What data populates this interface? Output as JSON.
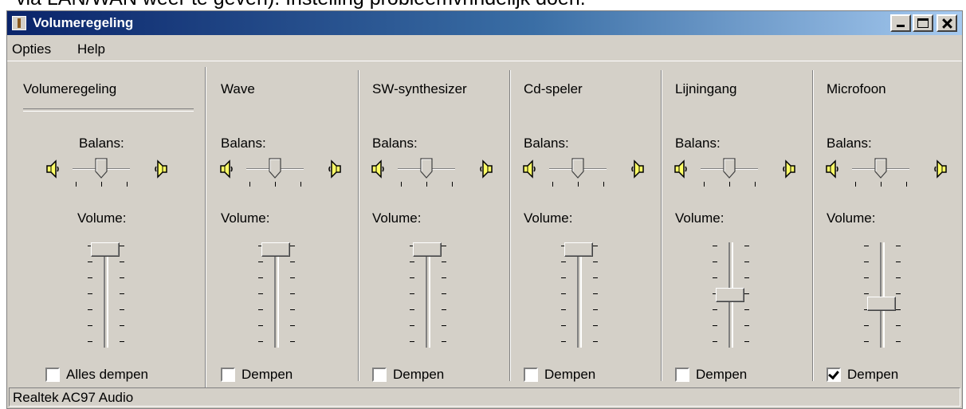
{
  "doc_text": "via LAN/WAN weer te geven). Instelling probleemvrindelijk doen.",
  "window": {
    "title": "Volumeregeling"
  },
  "menu": [
    "Opties",
    "Help"
  ],
  "labels": {
    "balance": "Balans:",
    "volume": "Volume:"
  },
  "strips": [
    {
      "name": "Volumeregeling",
      "mute_label": "Alles dempen",
      "muted": false,
      "volume_level": 1.0,
      "balance": 0.5
    },
    {
      "name": "Wave",
      "mute_label": "Dempen",
      "muted": false,
      "volume_level": 1.0,
      "balance": 0.5
    },
    {
      "name": "SW-synthesizer",
      "mute_label": "Dempen",
      "muted": false,
      "volume_level": 1.0,
      "balance": 0.5
    },
    {
      "name": "Cd-speler",
      "mute_label": "Dempen",
      "muted": false,
      "volume_level": 1.0,
      "balance": 0.5
    },
    {
      "name": "Lijningang",
      "mute_label": "Dempen",
      "muted": false,
      "volume_level": 0.5,
      "balance": 0.5
    },
    {
      "name": "Microfoon",
      "mute_label": "Dempen",
      "muted": true,
      "volume_level": 0.4,
      "balance": 0.5
    }
  ],
  "status": "Realtek AC97 Audio",
  "icons": {
    "speaker": "speaker-icon",
    "app": "volume-app-icon",
    "minimize": "minimize-icon",
    "maximize": "maximize-icon",
    "close": "close-icon"
  },
  "colors": {
    "face": "#d4d0c8",
    "title_start": "#0a246a",
    "title_end": "#a6caf0",
    "speaker_yellow": "#ffff66"
  }
}
